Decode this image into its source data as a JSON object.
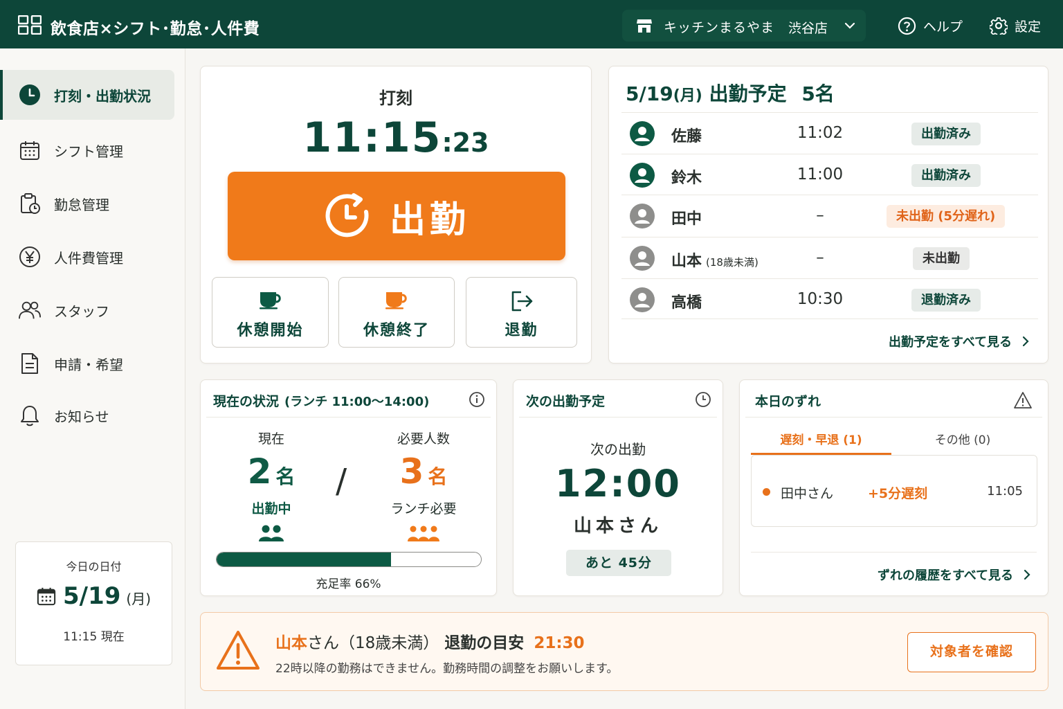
{
  "header": {
    "title": "飲食店×シフト･勤怠･人件費",
    "store_name": "キッチンまるやま",
    "store_branch": "渋谷店",
    "help_label": "ヘルプ",
    "settings_label": "設定"
  },
  "sidebar": {
    "items": [
      {
        "label": "打刻・出勤状況",
        "icon": "clock-icon",
        "active": true
      },
      {
        "label": "シフト管理",
        "icon": "calendar-icon"
      },
      {
        "label": "勤怠管理",
        "icon": "clipboard-clock-icon"
      },
      {
        "label": "人件費管理",
        "icon": "yen-icon"
      },
      {
        "label": "スタッフ",
        "icon": "people-icon"
      },
      {
        "label": "申請・希望",
        "icon": "document-icon"
      },
      {
        "label": "お知らせ",
        "icon": "bell-icon"
      }
    ],
    "date_card": {
      "label": "今日の日付",
      "date": "5/19",
      "dow": "(月)",
      "now": "11:15 現在"
    }
  },
  "punch": {
    "title": "打刻",
    "time_hm": "11:15",
    "time_sec": ":23",
    "clock_in_label": "出勤",
    "break_start_label": "休憩開始",
    "break_end_label": "休憩終了",
    "clock_out_label": "退勤"
  },
  "schedule": {
    "title_date": "5/19",
    "title_dow": "(月)",
    "title_text": "出勤予定",
    "title_count": "5名",
    "rows": [
      {
        "name": "佐藤",
        "note": "",
        "time": "11:02",
        "status": "出勤済み",
        "state": "in"
      },
      {
        "name": "鈴木",
        "note": "",
        "time": "11:00",
        "status": "出勤済み",
        "state": "in"
      },
      {
        "name": "田中",
        "note": "",
        "time": "–",
        "status": "未出勤 (5分遅れ)",
        "state": "late"
      },
      {
        "name": "山本",
        "note": "(18歳未満)",
        "time": "–",
        "status": "未出勤",
        "state": "absent"
      },
      {
        "name": "高橋",
        "note": "",
        "time": "10:30",
        "status": "退勤済み",
        "state": "out"
      }
    ],
    "see_all": "出勤予定をすべて見る"
  },
  "status": {
    "title": "現在の状況",
    "subtitle": "(ランチ 11:00〜14:00)",
    "current_label": "現在",
    "current_count": "2",
    "current_unit": "名",
    "current_caption": "出勤中",
    "required_label": "必要人数",
    "required_count": "3",
    "required_unit": "名",
    "required_caption": "ランチ必要",
    "fill_rate": 0.66,
    "fill_label": "充足率 66%",
    "slash": "/"
  },
  "next_shift": {
    "title": "次の出勤予定",
    "label": "次の出勤",
    "time": "12:00",
    "name": "山本さん",
    "remaining": "あと 45分"
  },
  "deviation": {
    "title": "本日のずれ",
    "tab_late": "遅刻・早退 (1)",
    "tab_other": "その他 (0)",
    "item_name": "田中さん",
    "item_status": "+5分遅刻",
    "item_time": "11:05",
    "see_all": "ずれの履歴をすべて見る"
  },
  "alert": {
    "name": "山本",
    "name_suffix": "さん（18歳未満）",
    "title_text": "退勤の目安",
    "time": "21:30",
    "description": "22時以降の勤務はできません。勤務時間の調整をお願いします。",
    "button_label": "対象者を確認"
  },
  "colors": {
    "primary": "#0d4639",
    "accent": "#f07a1a"
  }
}
